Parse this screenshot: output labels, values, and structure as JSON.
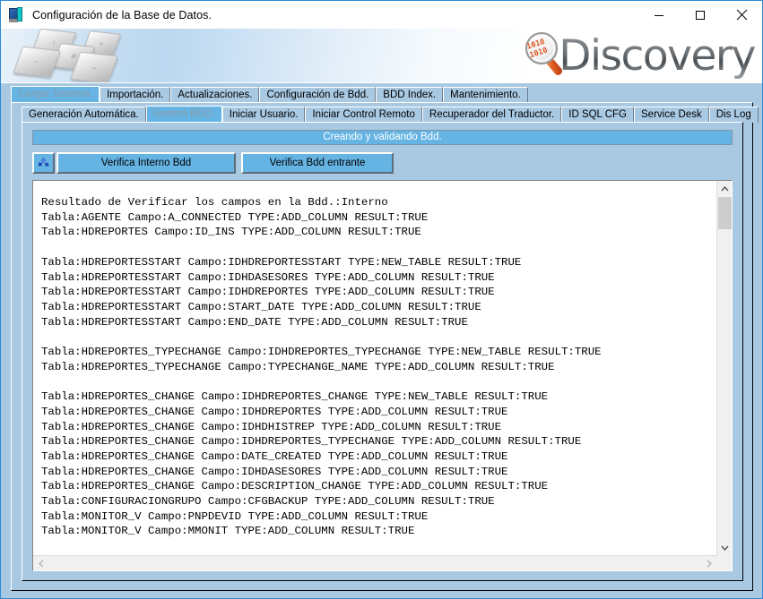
{
  "window": {
    "title": "Configuración de la Base de Datos.",
    "icon": "database-config-icon",
    "minimize_label": "Minimizar",
    "maximize_label": "Maximizar",
    "close_label": "Cerrar"
  },
  "banner": {
    "graphic": "keyboard-keys-graphic",
    "logo_text": "Discovery",
    "logo_icon": "magnifier-binary-icon",
    "logo_binary": "1010"
  },
  "outer_tabs": [
    {
      "label": "Cargar Sistema.",
      "selected": true
    },
    {
      "label": "Importación.",
      "selected": false
    },
    {
      "label": "Actualizaciones.",
      "selected": false
    },
    {
      "label": "Configuración de Bdd.",
      "selected": false
    },
    {
      "label": "BDD Index.",
      "selected": false
    },
    {
      "label": "Mantenimiento.",
      "selected": false
    }
  ],
  "inner_tabs": [
    {
      "label": "Generación Automática.",
      "selected": false
    },
    {
      "label": "Genera BDD.",
      "selected": true
    },
    {
      "label": "Iniciar Usuario.",
      "selected": false
    },
    {
      "label": "Iniciar Control Remoto",
      "selected": false
    },
    {
      "label": "Recuperador del Traductor.",
      "selected": false
    },
    {
      "label": "ID SQL CFG",
      "selected": false
    },
    {
      "label": "Service Desk",
      "selected": false
    },
    {
      "label": "Dis Log",
      "selected": false
    }
  ],
  "status": {
    "text": "Creando y validando Bdd.",
    "bar_color": "#65b4e4",
    "text_color": "#ffffff"
  },
  "actions": {
    "refresh_icon": "recycle-icon",
    "verify_internal_label": "Verifica Interno Bdd",
    "verify_incoming_label": "Verifica Bdd entrante"
  },
  "log": {
    "lines": [
      "Resultado de Verificar los campos en la Bdd.:Interno",
      "Tabla:AGENTE Campo:A_CONNECTED TYPE:ADD_COLUMN RESULT:TRUE",
      "Tabla:HDREPORTES Campo:ID_INS TYPE:ADD_COLUMN RESULT:TRUE",
      "",
      "Tabla:HDREPORTESSTART Campo:IDHDREPORTESSTART TYPE:NEW_TABLE RESULT:TRUE",
      "Tabla:HDREPORTESSTART Campo:IDHDASESORES TYPE:ADD_COLUMN RESULT:TRUE",
      "Tabla:HDREPORTESSTART Campo:IDHDREPORTES TYPE:ADD_COLUMN RESULT:TRUE",
      "Tabla:HDREPORTESSTART Campo:START_DATE TYPE:ADD_COLUMN RESULT:TRUE",
      "Tabla:HDREPORTESSTART Campo:END_DATE TYPE:ADD_COLUMN RESULT:TRUE",
      "",
      "Tabla:HDREPORTES_TYPECHANGE Campo:IDHDREPORTES_TYPECHANGE TYPE:NEW_TABLE RESULT:TRUE",
      "Tabla:HDREPORTES_TYPECHANGE Campo:TYPECHANGE_NAME TYPE:ADD_COLUMN RESULT:TRUE",
      "",
      "Tabla:HDREPORTES_CHANGE Campo:IDHDREPORTES_CHANGE TYPE:NEW_TABLE RESULT:TRUE",
      "Tabla:HDREPORTES_CHANGE Campo:IDHDREPORTES TYPE:ADD_COLUMN RESULT:TRUE",
      "Tabla:HDREPORTES_CHANGE Campo:IDHDHISTREP TYPE:ADD_COLUMN RESULT:TRUE",
      "Tabla:HDREPORTES_CHANGE Campo:IDHDREPORTES_TYPECHANGE TYPE:ADD_COLUMN RESULT:TRUE",
      "Tabla:HDREPORTES_CHANGE Campo:DATE_CREATED TYPE:ADD_COLUMN RESULT:TRUE",
      "Tabla:HDREPORTES_CHANGE Campo:IDHDASESORES TYPE:ADD_COLUMN RESULT:TRUE",
      "Tabla:HDREPORTES_CHANGE Campo:DESCRIPTION_CHANGE TYPE:ADD_COLUMN RESULT:TRUE",
      "Tabla:CONFIGURACIONGRUPO Campo:CFGBACKUP TYPE:ADD_COLUMN RESULT:TRUE",
      "Tabla:MONITOR_V Campo:PNPDEVID TYPE:ADD_COLUMN RESULT:TRUE",
      "Tabla:MONITOR_V Campo:MMONIT TYPE:ADD_COLUMN RESULT:TRUE"
    ]
  },
  "scrollbars": {
    "vertical_up_glyph": "⌃",
    "vertical_down_glyph": "⌄",
    "horizontal_left_glyph": "‹",
    "horizontal_right_glyph": "›"
  },
  "colors": {
    "client_background": "#a9c9e3",
    "accent_blue": "#65b4e4",
    "window_border": "#2e8ad4"
  }
}
